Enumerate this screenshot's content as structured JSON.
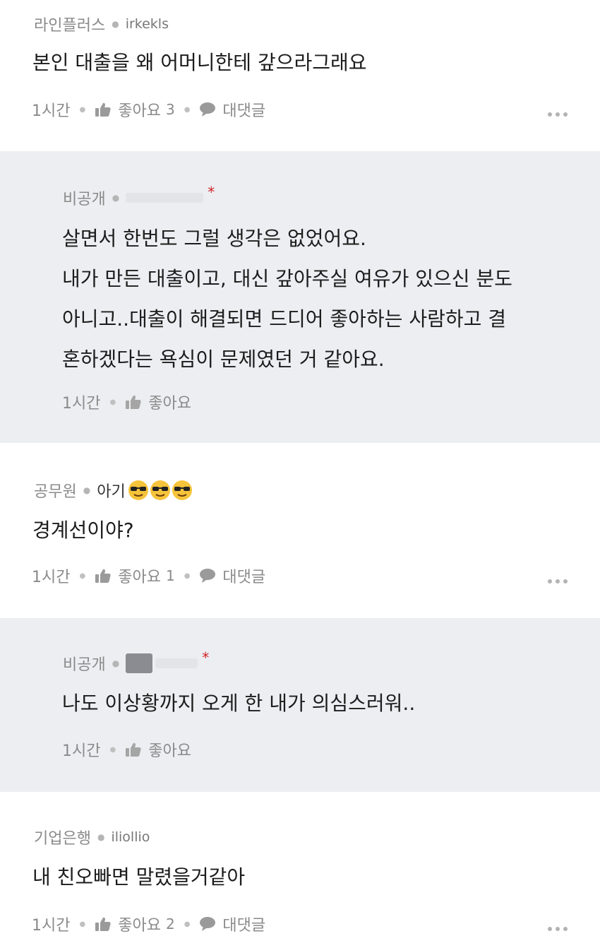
{
  "comments": [
    {
      "company": "라인플러스",
      "nickname": "irkekls",
      "text": "본인 대출을 왜 어머니한테 갚으라그래요",
      "time": "1시간",
      "like_label": "좋아요",
      "like_count": "3",
      "reply_label": "대댓글"
    },
    {
      "company": "비공개",
      "text_lines": [
        "살면서 한번도 그럴 생각은 없었어요.",
        "내가 만든 대출이고, 대신 갚아주실 여유가 있으신 분도",
        "아니고..대출이 해결되면 드디어 좋아하는 사람하고 결",
        "혼하겠다는 욕심이 문제였던 거 같아요."
      ],
      "time": "1시간",
      "like_label": "좋아요"
    },
    {
      "company": "공무원",
      "nickname": "아기",
      "emoji": [
        "sunglasses-emoji",
        "sunglasses-emoji",
        "sunglasses-emoji"
      ],
      "text": "경계선이야?",
      "time": "1시간",
      "like_label": "좋아요",
      "like_count": "1",
      "reply_label": "대댓글"
    },
    {
      "company": "비공개",
      "text": "나도 이상황까지 오게 한 내가 의심스러워..",
      "time": "1시간",
      "like_label": "좋아요"
    },
    {
      "company": "기업은행",
      "nickname": "iliollio",
      "text": "내 친오빠면 말렸을거같아",
      "time": "1시간",
      "like_label": "좋아요",
      "like_count": "2",
      "reply_label": "대댓글"
    }
  ],
  "icons": {
    "like": "thumbs-up-icon",
    "reply": "speech-bubble-icon",
    "more": "more-dots-icon",
    "author_marker": "asterisk"
  },
  "colors": {
    "reply_background": "#eceef1",
    "author_marker": "#d2232a",
    "meta_text": "#8a8a8a"
  }
}
